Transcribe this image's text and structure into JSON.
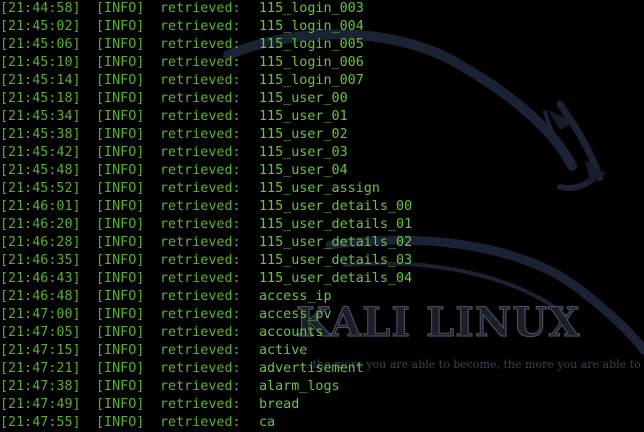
{
  "wallpaper": {
    "title": "KALI LINUX",
    "quote": "...the more you are able to become, the more you are able to hear."
  },
  "log": [
    {
      "time": "[21:44:58]",
      "level": "[INFO]",
      "message": "retrieved:",
      "name": "115_login_003"
    },
    {
      "time": "[21:45:02]",
      "level": "[INFO]",
      "message": "retrieved:",
      "name": "115_login_004"
    },
    {
      "time": "[21:45:06]",
      "level": "[INFO]",
      "message": "retrieved:",
      "name": "115_login_005"
    },
    {
      "time": "[21:45:10]",
      "level": "[INFO]",
      "message": "retrieved:",
      "name": "115_login_006"
    },
    {
      "time": "[21:45:14]",
      "level": "[INFO]",
      "message": "retrieved:",
      "name": "115_login_007"
    },
    {
      "time": "[21:45:18]",
      "level": "[INFO]",
      "message": "retrieved:",
      "name": "115_user_00"
    },
    {
      "time": "[21:45:34]",
      "level": "[INFO]",
      "message": "retrieved:",
      "name": "115_user_01"
    },
    {
      "time": "[21:45:38]",
      "level": "[INFO]",
      "message": "retrieved:",
      "name": "115_user_02"
    },
    {
      "time": "[21:45:42]",
      "level": "[INFO]",
      "message": "retrieved:",
      "name": "115_user_03"
    },
    {
      "time": "[21:45:48]",
      "level": "[INFO]",
      "message": "retrieved:",
      "name": "115_user_04"
    },
    {
      "time": "[21:45:52]",
      "level": "[INFO]",
      "message": "retrieved:",
      "name": "115_user_assign"
    },
    {
      "time": "[21:46:01]",
      "level": "[INFO]",
      "message": "retrieved:",
      "name": "115_user_details_00"
    },
    {
      "time": "[21:46:20]",
      "level": "[INFO]",
      "message": "retrieved:",
      "name": "115_user_details_01"
    },
    {
      "time": "[21:46:28]",
      "level": "[INFO]",
      "message": "retrieved:",
      "name": "115_user_details_02"
    },
    {
      "time": "[21:46:35]",
      "level": "[INFO]",
      "message": "retrieved:",
      "name": "115_user_details_03"
    },
    {
      "time": "[21:46:43]",
      "level": "[INFO]",
      "message": "retrieved:",
      "name": "115_user_details_04"
    },
    {
      "time": "[21:46:48]",
      "level": "[INFO]",
      "message": "retrieved:",
      "name": "access_ip"
    },
    {
      "time": "[21:47:00]",
      "level": "[INFO]",
      "message": "retrieved:",
      "name": "access_pv"
    },
    {
      "time": "[21:47:05]",
      "level": "[INFO]",
      "message": "retrieved:",
      "name": "accounts"
    },
    {
      "time": "[21:47:15]",
      "level": "[INFO]",
      "message": "retrieved:",
      "name": "active"
    },
    {
      "time": "[21:47:21]",
      "level": "[INFO]",
      "message": "retrieved:",
      "name": "advertisement"
    },
    {
      "time": "[21:47:38]",
      "level": "[INFO]",
      "message": "retrieved:",
      "name": "alarm_logs"
    },
    {
      "time": "[21:47:49]",
      "level": "[INFO]",
      "message": "retrieved:",
      "name": "bread"
    },
    {
      "time": "[21:47:55]",
      "level": "[INFO]",
      "message": "retrieved:",
      "name": "ca"
    }
  ]
}
